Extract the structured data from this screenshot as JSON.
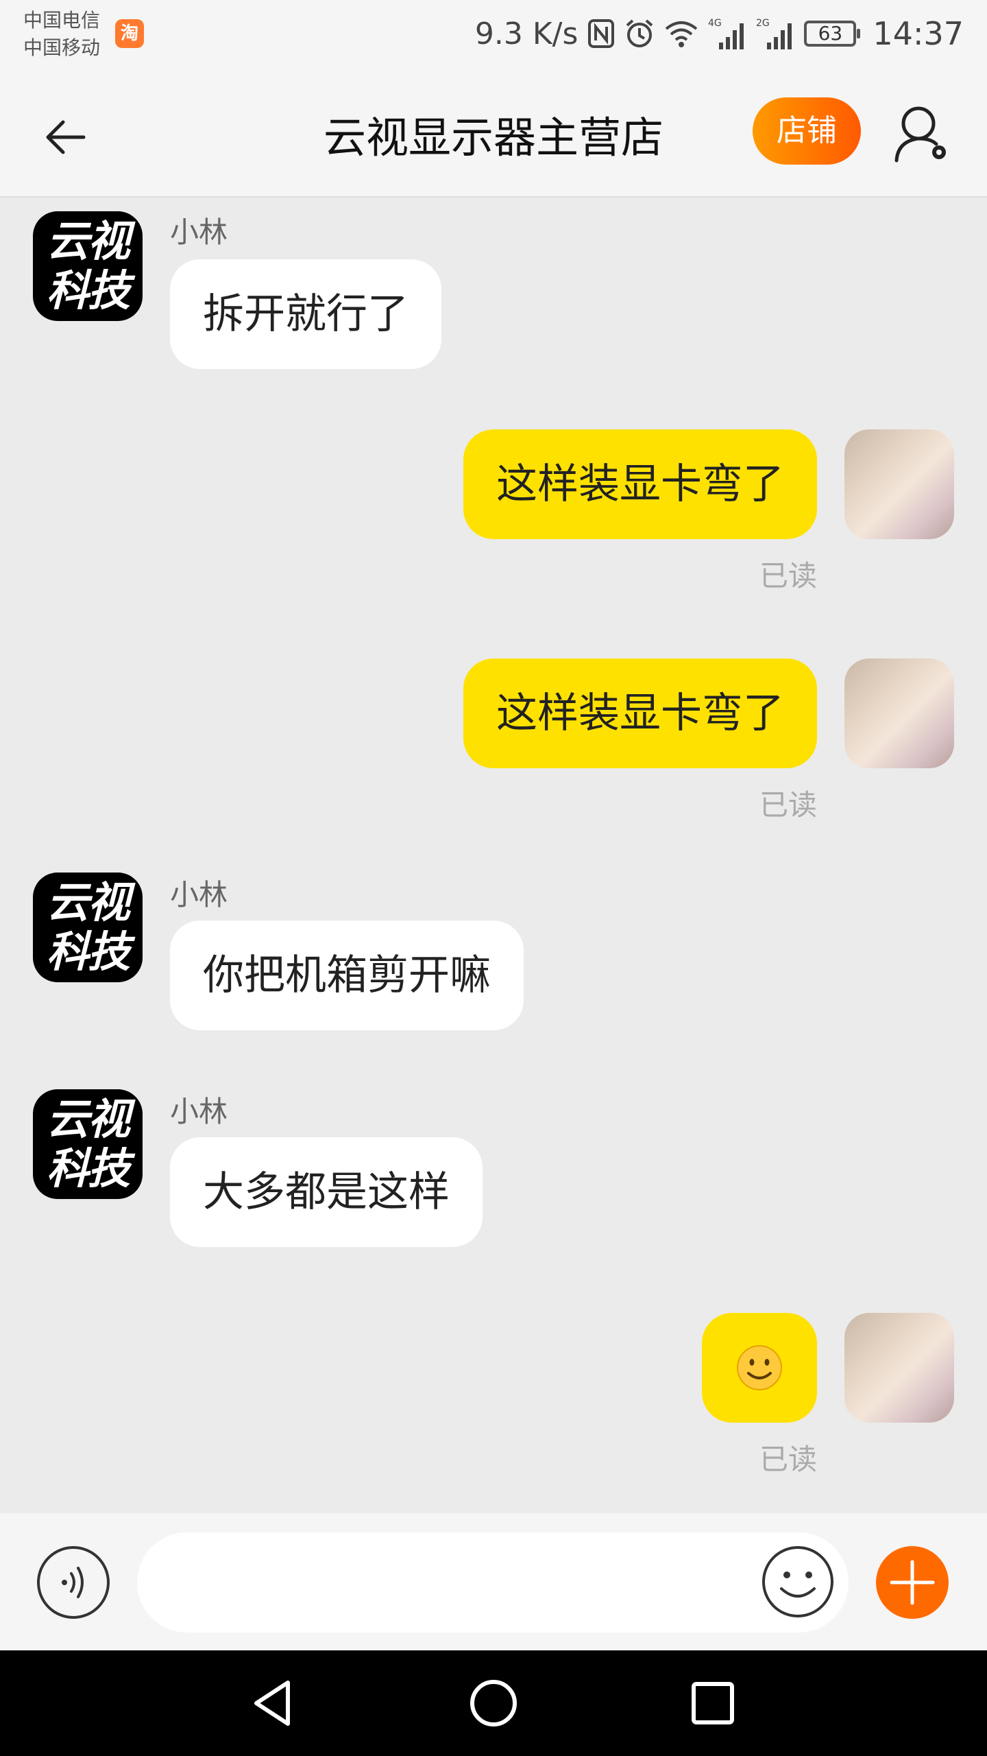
{
  "status_bar": {
    "carrier_1": "中国电信",
    "carrier_2": "中国移动",
    "app_badge": "淘",
    "net_speed": "9.3 K/s",
    "signal_1_type": "4G",
    "signal_2_type": "2G",
    "battery": "63",
    "time": "14:37"
  },
  "header": {
    "title": "云视显示器主营店",
    "shop_button": "店铺"
  },
  "shop_avatar_text": {
    "line1": "云视",
    "line2": "科技"
  },
  "messages": [
    {
      "direction": "in",
      "sender": "小林",
      "text": "拆开就行了"
    },
    {
      "direction": "out",
      "text": "这样装显卡弯了",
      "status": "已读"
    },
    {
      "direction": "out",
      "text": "这样装显卡弯了",
      "status": "已读"
    },
    {
      "direction": "in",
      "sender": "小林",
      "text": "你把机箱剪开嘛"
    },
    {
      "direction": "in",
      "sender": "小林",
      "text": "大多都是这样"
    },
    {
      "direction": "out",
      "emoji": "slightly-smiling-face",
      "status": "已读"
    }
  ],
  "input_bar": {
    "placeholder": ""
  },
  "colors": {
    "accent_orange": "#ff6a00",
    "outgoing_bubble": "#ffe100",
    "incoming_bubble": "#ffffff",
    "chat_background": "#ebebeb"
  }
}
